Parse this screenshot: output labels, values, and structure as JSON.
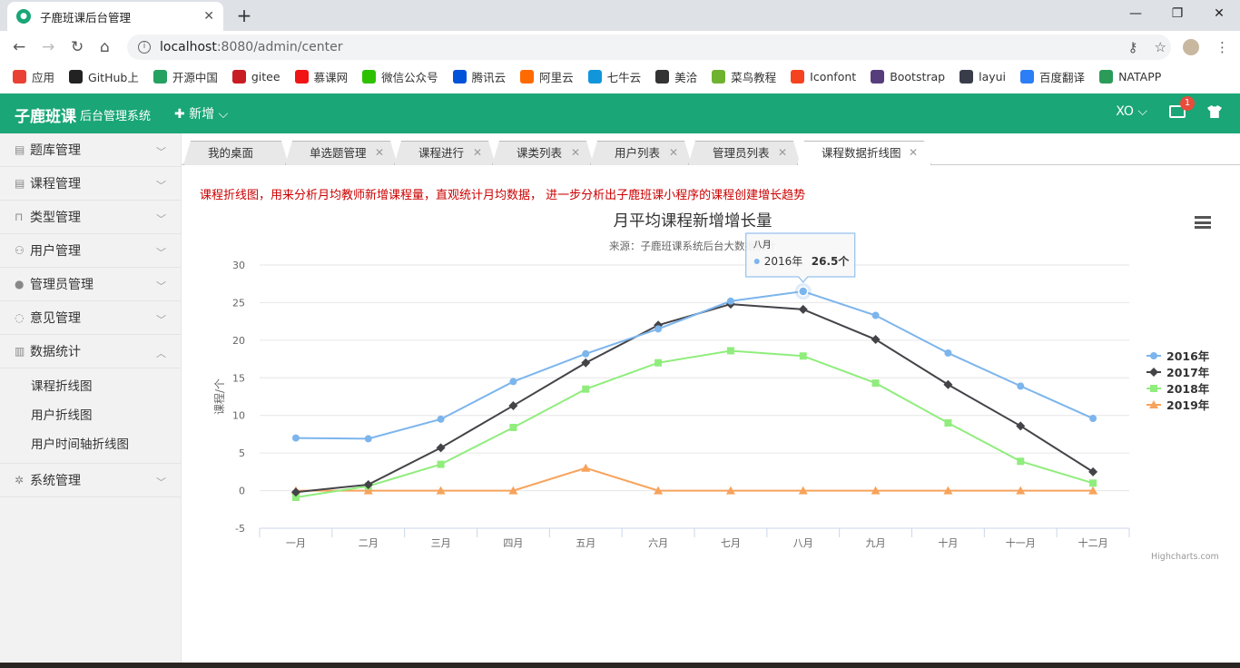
{
  "browser": {
    "tab_title": "子鹿班课后台管理",
    "url_host": "localhost",
    "url_path": ":8080/admin/center",
    "bookmarks": [
      "应用",
      "GitHub上",
      "开源中国",
      "gitee",
      "慕课网",
      "微信公众号",
      "腾讯云",
      "阿里云",
      "七牛云",
      "美洽",
      "菜鸟教程",
      "Iconfont",
      "Bootstrap",
      "layui",
      "百度翻译",
      "NATAPP"
    ],
    "bookmark_colors": [
      "#e94235",
      "#222222",
      "#25a162",
      "#c71d23",
      "#f01414",
      "#2dc100",
      "#0052d9",
      "#ff6a00",
      "#1296db",
      "#333333",
      "#6fb22f",
      "#f6431f",
      "#563d7c",
      "#393d49",
      "#2b7ef5",
      "#2b9b5a"
    ]
  },
  "header": {
    "logo": "子鹿班课",
    "subtitle": "后台管理系统",
    "add_new": "✚ 新增 ⌵",
    "user": "XO ⌵",
    "mail_badge": "1",
    "brand_color": "#1aa676"
  },
  "sidebar": {
    "items": [
      {
        "label": "题库管理",
        "icon": "▤"
      },
      {
        "label": "课程管理",
        "icon": "▤"
      },
      {
        "label": "类型管理",
        "icon": "⊓"
      },
      {
        "label": "用户管理",
        "icon": "⚇"
      },
      {
        "label": "管理员管理",
        "icon": "●"
      },
      {
        "label": "意见管理",
        "icon": "◌"
      },
      {
        "label": "数据统计",
        "icon": "▥"
      },
      {
        "label": "系统管理",
        "icon": "✲"
      }
    ],
    "submenu": [
      "课程折线图",
      "用户折线图",
      "用户时间轴折线图"
    ]
  },
  "tabs": [
    "我的桌面",
    "单选题管理",
    "课程进行",
    "课类列表",
    "用户列表",
    "管理员列表",
    "课程数据折线图"
  ],
  "content": {
    "description": "课程折线图，用来分析月均教师新增课程量，直观统计月均数据，  进一步分析出子鹿班课小程序的课程创建增长趋势",
    "credits": "Highcharts.com"
  },
  "chart_data": {
    "type": "line",
    "title": "月平均课程新增增长量",
    "subtitle": "来源：子鹿班课系统后台大数据统计",
    "ylabel": "课程/个",
    "xlabel": "",
    "ylim": [
      -5,
      30
    ],
    "yticks": [
      -5,
      0,
      5,
      10,
      15,
      20,
      25,
      30
    ],
    "categories": [
      "一月",
      "二月",
      "三月",
      "四月",
      "五月",
      "六月",
      "七月",
      "八月",
      "九月",
      "十月",
      "十一月",
      "十二月"
    ],
    "legend_position": "right",
    "series": [
      {
        "name": "2016年",
        "color": "#7cb5ec",
        "marker": "circle",
        "values": [
          7.0,
          6.9,
          9.5,
          14.5,
          18.2,
          21.5,
          25.2,
          26.5,
          23.3,
          18.3,
          13.9,
          9.6
        ]
      },
      {
        "name": "2017年",
        "color": "#434348",
        "marker": "diamond",
        "values": [
          -0.2,
          0.8,
          5.7,
          11.3,
          17.0,
          22.0,
          24.8,
          24.1,
          20.1,
          14.1,
          8.6,
          2.5
        ]
      },
      {
        "name": "2018年",
        "color": "#90ed7d",
        "marker": "square",
        "values": [
          -0.9,
          0.6,
          3.5,
          8.4,
          13.5,
          17.0,
          18.6,
          17.9,
          14.3,
          9.0,
          3.9,
          1.0
        ]
      },
      {
        "name": "2019年",
        "color": "#f7a35c",
        "marker": "triangle",
        "values": [
          0,
          0,
          0,
          0,
          3,
          0,
          0,
          0,
          0,
          0,
          0,
          0
        ]
      }
    ],
    "tooltip": {
      "category": "八月",
      "series": "2016年",
      "value_text": "26.5个"
    }
  }
}
